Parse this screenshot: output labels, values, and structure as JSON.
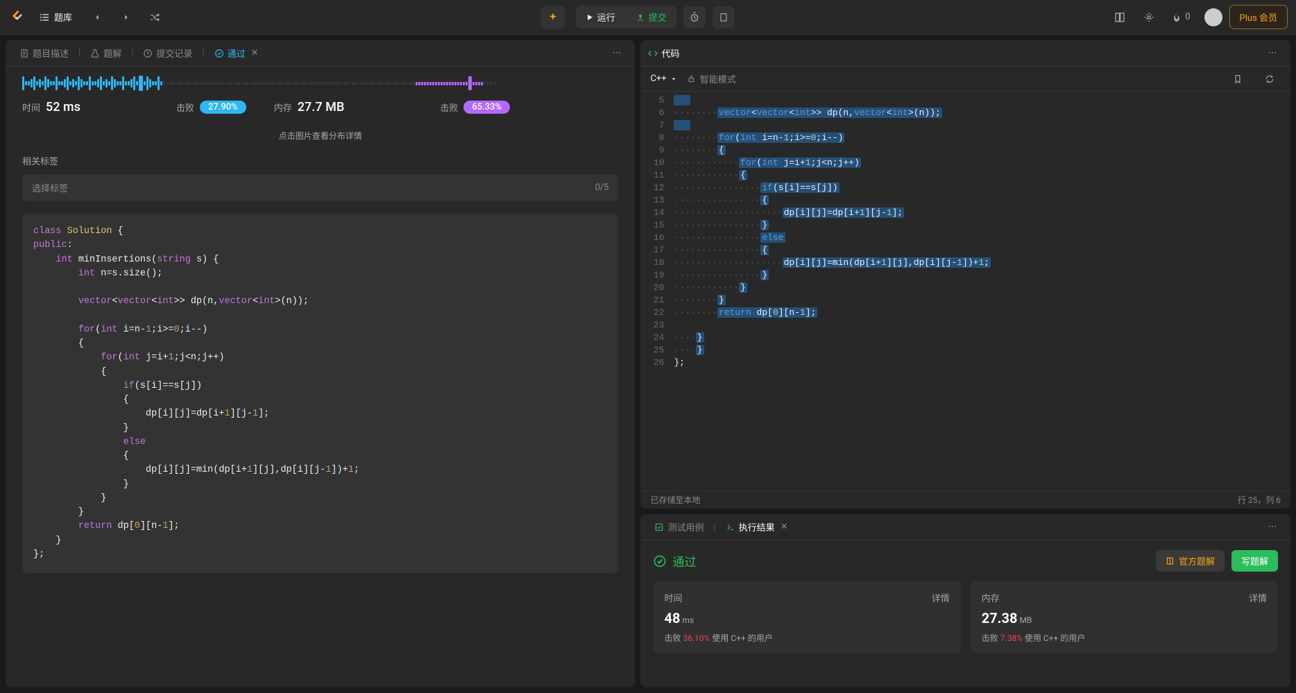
{
  "topbar": {
    "problems_label": "题库",
    "run_label": "运行",
    "submit_label": "提交",
    "streak_count": "0",
    "plus_label": "Plus 会员"
  },
  "left_panel": {
    "tabs": {
      "description": "题目描述",
      "solution": "题解",
      "submissions": "提交记录",
      "result": "通过"
    },
    "stats": {
      "time_label": "时间",
      "time_value": "52 ms",
      "time_beat_label": "击败",
      "time_beat_value": "27.90%",
      "mem_label": "内存",
      "mem_value": "27.7 MB",
      "mem_beat_label": "击败",
      "mem_beat_value": "65.33%"
    },
    "center_note": "点击图片查看分布详情",
    "tags_label": "相关标签",
    "tag_placeholder": "选择标签",
    "tag_count": "0/5",
    "code_lines": [
      {
        "t": "class ",
        "c": "kw-class",
        "rest": "Solution {",
        "rc": "ident"
      },
      {
        "raw": "public:"
      },
      {
        "raw": "    int minInsertions(string s) {"
      },
      {
        "raw": "        int n=s.size();"
      },
      {
        "raw": ""
      },
      {
        "raw": "        vector<vector<int>> dp(n,vector<int>(n));"
      },
      {
        "raw": ""
      },
      {
        "raw": "        for(int i=n-1;i>=0;i--)"
      },
      {
        "raw": "        {"
      },
      {
        "raw": "            for(int j=i+1;j<n;j++)"
      },
      {
        "raw": "            {"
      },
      {
        "raw": "                if(s[i]==s[j])"
      },
      {
        "raw": "                {"
      },
      {
        "raw": "                    dp[i][j]=dp[i+1][j-1];"
      },
      {
        "raw": "                }"
      },
      {
        "raw": "                else"
      },
      {
        "raw": "                {"
      },
      {
        "raw": "                    dp[i][j]=min(dp[i+1][j],dp[i][j-1])+1;"
      },
      {
        "raw": "                }"
      },
      {
        "raw": "            }"
      },
      {
        "raw": "        }"
      },
      {
        "raw": "        return dp[0][n-1];"
      },
      {
        "raw": "    }"
      },
      {
        "raw": "};"
      }
    ]
  },
  "code_panel": {
    "header": "代码",
    "language": "C++",
    "smart_mode": "智能模式",
    "saved_text": "已存储至本地",
    "cursor_text": "行 25，列 6",
    "lines": [
      {
        "n": 5,
        "text": "",
        "hl": true
      },
      {
        "n": 6,
        "text": "        vector<vector<int>> dp(n,vector<int>(n));",
        "hl": true
      },
      {
        "n": 7,
        "text": "",
        "hl": true
      },
      {
        "n": 8,
        "text": "        for(int i=n-1;i>=0;i--)",
        "hl": true
      },
      {
        "n": 9,
        "text": "        {",
        "hl": true
      },
      {
        "n": 10,
        "text": "            for(int j=i+1;j<n;j++)",
        "hl": true
      },
      {
        "n": 11,
        "text": "            {",
        "hl": true
      },
      {
        "n": 12,
        "text": "                if(s[i]==s[j])",
        "hl": true
      },
      {
        "n": 13,
        "text": "                {",
        "hl": true
      },
      {
        "n": 14,
        "text": "                    dp[i][j]=dp[i+1][j-1];",
        "hl": true
      },
      {
        "n": 15,
        "text": "                }",
        "hl": true
      },
      {
        "n": 16,
        "text": "                else",
        "hl": true
      },
      {
        "n": 17,
        "text": "                {",
        "hl": true
      },
      {
        "n": 18,
        "text": "                    dp[i][j]=min(dp[i+1][j],dp[i][j-1])+1;",
        "hl": true
      },
      {
        "n": 19,
        "text": "                }",
        "hl": true
      },
      {
        "n": 20,
        "text": "            }",
        "hl": true
      },
      {
        "n": 21,
        "text": "        }",
        "hl": true
      },
      {
        "n": 22,
        "text": "        return dp[0][n-1];",
        "hl": true
      },
      {
        "n": 23,
        "text": "",
        "hl": false
      },
      {
        "n": 24,
        "text": "    }",
        "hl": true
      },
      {
        "n": 25,
        "text": "    }",
        "hl": true,
        "cursor": true
      },
      {
        "n": 26,
        "text": "};",
        "hl": false
      }
    ]
  },
  "result_panel": {
    "tab_testcase": "测试用例",
    "tab_result": "执行结果",
    "pass_text": "通过",
    "official_solution": "官方题解",
    "write_solution": "写题解",
    "cards": {
      "time_label": "时间",
      "time_value": "48",
      "time_unit": "ms",
      "time_beat_prefix": "击败 ",
      "time_beat_pct": "36.10%",
      "time_beat_suffix": " 使用 C++ 的用户",
      "mem_label": "内存",
      "mem_value": "27.38",
      "mem_unit": "MB",
      "mem_beat_prefix": "击败 ",
      "mem_beat_pct": "7.38%",
      "mem_beat_suffix": " 使用 C++ 的用户",
      "detail": "详情"
    }
  }
}
